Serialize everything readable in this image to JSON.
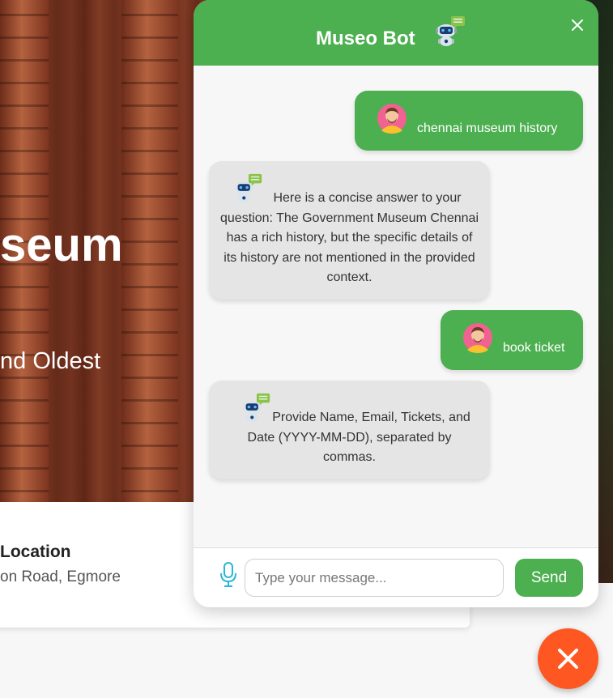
{
  "page": {
    "hero_title": "seum",
    "hero_subtitle": "nd Oldest",
    "info_title": "Location",
    "info_text": "on Road, Egmore"
  },
  "chat": {
    "title": "Museo Bot",
    "close_icon": "close-icon",
    "header_icon": "robot-chat-icon",
    "messages": [
      {
        "role": "user",
        "avatar": "user-avatar-icon",
        "text": "chennai museum history"
      },
      {
        "role": "bot",
        "avatar": "robot-chat-icon",
        "text": "Here is a concise answer to your question: The Government Museum Chennai has a rich history, but the specific details of its history are not mentioned in the provided context."
      },
      {
        "role": "user",
        "avatar": "user-avatar-icon",
        "text": "book ticket"
      },
      {
        "role": "bot",
        "avatar": "robot-chat-icon",
        "text": "Provide Name, Email, Tickets, and Date (YYYY-MM-DD), separated by commas."
      }
    ],
    "input": {
      "placeholder": "Type your message...",
      "value": ""
    },
    "send_label": "Send",
    "mic_icon": "microphone-icon"
  },
  "fab": {
    "icon": "close-icon"
  },
  "colors": {
    "header_green": "#4caf50",
    "user_bubble": "#4caf50",
    "bot_bubble": "#e5e5e5",
    "fab_orange": "#ff5722",
    "mic_blue": "#29b6d8"
  }
}
